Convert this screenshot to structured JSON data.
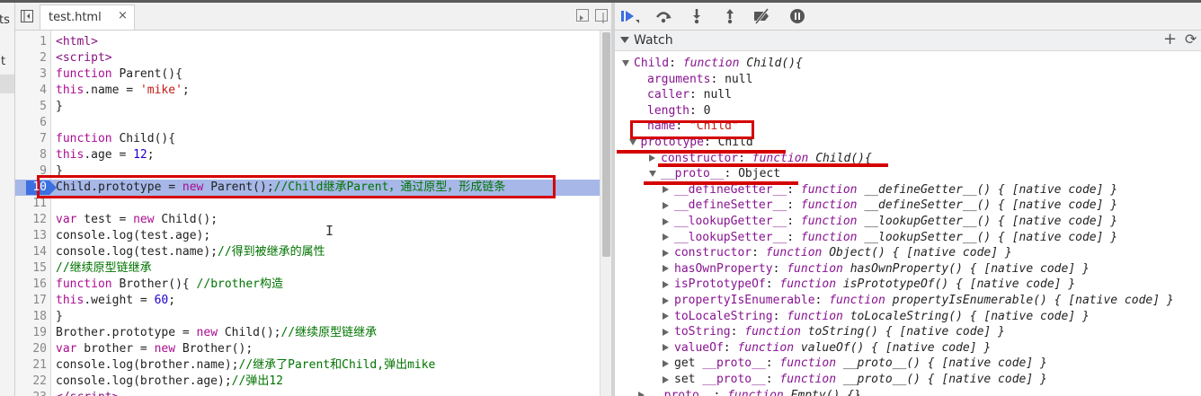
{
  "left_nav": {
    "fragment_top": "ts",
    "fragment_mid": "t"
  },
  "editor": {
    "tab_label": "test.html",
    "tab_close": "×",
    "current_line": "10",
    "lines": [
      {
        "n": "1",
        "html": "<span class=\"t\">&lt;html&gt;</span>"
      },
      {
        "n": "2",
        "html": "<span class=\"t\">&lt;script&gt;</span>"
      },
      {
        "n": "3",
        "html": "<span class=\"k\">function</span> Parent(){"
      },
      {
        "n": "4",
        "html": "<span class=\"k\">this</span>.name = <span class=\"s\">'mike'</span>;"
      },
      {
        "n": "5",
        "html": "}"
      },
      {
        "n": "6",
        "html": ""
      },
      {
        "n": "7",
        "html": "<span class=\"k\">function</span> Child(){"
      },
      {
        "n": "8",
        "html": "<span class=\"k\">this</span>.age = <span class=\"n\">12</span>;"
      },
      {
        "n": "9",
        "html": "}"
      },
      {
        "n": "10",
        "html": "Child.prototype = <span class=\"k\">new</span> Parent();<span class=\"c\">//Child继承Parent，通过原型，形成链条</span>"
      },
      {
        "n": "11",
        "html": ""
      },
      {
        "n": "12",
        "html": "<span class=\"k\">var</span> test = <span class=\"k\">new</span> Child();"
      },
      {
        "n": "13",
        "html": "console.log(test.age);"
      },
      {
        "n": "14",
        "html": "console.log(test.name);<span class=\"c\">//得到被继承的属性</span>"
      },
      {
        "n": "15",
        "html": "<span class=\"c\">//继续原型链继承</span>"
      },
      {
        "n": "16",
        "html": "<span class=\"k\">function</span> Brother(){ <span class=\"c\">//brother构造</span>"
      },
      {
        "n": "17",
        "html": "<span class=\"k\">this</span>.weight = <span class=\"n\">60</span>;"
      },
      {
        "n": "18",
        "html": "}"
      },
      {
        "n": "19",
        "html": "Brother.prototype = <span class=\"k\">new</span> Child();<span class=\"c\">//继续原型链继承</span>"
      },
      {
        "n": "20",
        "html": "<span class=\"k\">var</span> brother = <span class=\"k\">new</span> Brother();"
      },
      {
        "n": "21",
        "html": "console.log(brother.name);<span class=\"c\">//继承了Parent和Child,弹出mike</span>"
      },
      {
        "n": "22",
        "html": "console.log(brother.age);<span class=\"c\">//弹出12</span>"
      },
      {
        "n": "23",
        "html": "<span class=\"t\">&lt;/script&gt;</span>"
      }
    ]
  },
  "debugger": {
    "watch_title": "Watch",
    "add_symbol": "+",
    "refresh_symbol": "⟳",
    "rows": [
      {
        "indent": 0,
        "tri": "open",
        "html": "<span class=\"key\">Child</span>: <span class=\"fn\">function</span> <span class=\"fnv\">Child(){</span>"
      },
      {
        "indent": 1,
        "tri": "none",
        "html": "<span class=\"key\">arguments</span>: <span class=\"val\">null</span>"
      },
      {
        "indent": 1,
        "tri": "none",
        "html": "<span class=\"key\">caller</span>: <span class=\"val\">null</span>"
      },
      {
        "indent": 1,
        "tri": "none",
        "html": "<span class=\"key\">length</span>: <span class=\"val\">0</span>"
      },
      {
        "indent": 1,
        "tri": "none",
        "html": "<span class=\"key\">name</span>: <span class=\"str\">\"Child\"</span>"
      },
      {
        "indent": 0.5,
        "tri": "open",
        "html": "<span class=\"key\">prototype</span>: <span class=\"val\">Child</span>"
      },
      {
        "indent": 2,
        "tri": "closed",
        "html": "<span class=\"key\">constructor</span>: <span class=\"fn\">function</span> <span class=\"fnv\">Child(){</span>"
      },
      {
        "indent": 2,
        "tri": "open",
        "html": "<span class=\"key\">__proto__</span>: <span class=\"val\">Object</span>"
      },
      {
        "indent": 3,
        "tri": "closed",
        "html": "<span class=\"key\">__defineGetter__</span>: <span class=\"fn\">function</span> <span class=\"nat\">__defineGetter__() { [native code] }</span>"
      },
      {
        "indent": 3,
        "tri": "closed",
        "html": "<span class=\"key\">__defineSetter__</span>: <span class=\"fn\">function</span> <span class=\"nat\">__defineSetter__() { [native code] }</span>"
      },
      {
        "indent": 3,
        "tri": "closed",
        "html": "<span class=\"key\">__lookupGetter__</span>: <span class=\"fn\">function</span> <span class=\"nat\">__lookupGetter__() { [native code] }</span>"
      },
      {
        "indent": 3,
        "tri": "closed",
        "html": "<span class=\"key\">__lookupSetter__</span>: <span class=\"fn\">function</span> <span class=\"nat\">__lookupSetter__() { [native code] }</span>"
      },
      {
        "indent": 3,
        "tri": "closed",
        "html": "<span class=\"key\">constructor</span>: <span class=\"fn\">function</span> <span class=\"nat\">Object() { [native code] }</span>"
      },
      {
        "indent": 3,
        "tri": "closed",
        "html": "<span class=\"key\">hasOwnProperty</span>: <span class=\"fn\">function</span> <span class=\"nat\">hasOwnProperty() { [native code] }</span>"
      },
      {
        "indent": 3,
        "tri": "closed",
        "html": "<span class=\"key\">isPrototypeOf</span>: <span class=\"fn\">function</span> <span class=\"nat\">isPrototypeOf() { [native code] }</span>"
      },
      {
        "indent": 3,
        "tri": "closed",
        "html": "<span class=\"key\">propertyIsEnumerable</span>: <span class=\"fn\">function</span> <span class=\"nat\">propertyIsEnumerable() { [native code] }</span>"
      },
      {
        "indent": 3,
        "tri": "closed",
        "html": "<span class=\"key\">toLocaleString</span>: <span class=\"fn\">function</span> <span class=\"nat\">toLocaleString() { [native code] }</span>"
      },
      {
        "indent": 3,
        "tri": "closed",
        "html": "<span class=\"key\">toString</span>: <span class=\"fn\">function</span> <span class=\"nat\">toString() { [native code] }</span>"
      },
      {
        "indent": 3,
        "tri": "closed",
        "html": "<span class=\"key\">valueOf</span>: <span class=\"fn\">function</span> <span class=\"nat\">valueOf() { [native code] }</span>"
      },
      {
        "indent": 3,
        "tri": "closed",
        "html": "<span class=\"val\">get</span> <span class=\"key\">__proto__</span>: <span class=\"fn\">function</span> <span class=\"nat\">__proto__() { [native code] }</span>"
      },
      {
        "indent": 3,
        "tri": "closed",
        "html": "<span class=\"val\">set</span> <span class=\"key\">__proto__</span>: <span class=\"fn\">function</span> <span class=\"nat\">__proto__() { [native code] }</span>"
      },
      {
        "indent": 1.2,
        "tri": "closed",
        "html": "<span class=\"key\">__proto__</span>: <span class=\"fn\">function</span> <span class=\"nat\">Empty() {}</span>"
      }
    ]
  },
  "colors": {
    "accent": "#3c6fe0",
    "highlight": "#a6b7e8",
    "annotation": "#d50000"
  }
}
